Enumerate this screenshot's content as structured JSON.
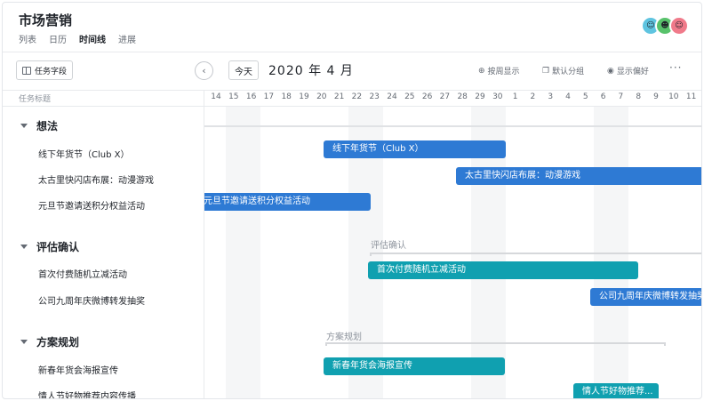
{
  "header": {
    "title": "市场营销",
    "tabs": [
      "列表",
      "日历",
      "时间线",
      "进展"
    ],
    "active_tab": "时间线",
    "avatars": [
      {
        "initial": "☺",
        "color": "#5fc4e0"
      },
      {
        "initial": "☻",
        "color": "#58c26b"
      },
      {
        "initial": "☺",
        "color": "#f07a8a"
      }
    ]
  },
  "toolbar": {
    "fields_label": "任务字段",
    "prev_icon": "chevron-left-icon",
    "today_label": "今天",
    "month": "2020 年 4 月",
    "week_label": "按周显示",
    "group_label": "默认分组",
    "prefs_label": "显示偏好",
    "more_label": "···"
  },
  "grid": {
    "column_title": "任务标题",
    "days": [
      "14",
      "15",
      "16",
      "17",
      "18",
      "19",
      "20",
      "21",
      "22",
      "23",
      "24",
      "25",
      "26",
      "27",
      "28",
      "29",
      "30",
      "1",
      "2",
      "3",
      "4",
      "5",
      "6",
      "7",
      "8",
      "9",
      "10",
      "11",
      "12",
      "13"
    ]
  },
  "groups": [
    {
      "name": "想法",
      "tasks": [
        {
          "name": "线下年货节（Club X）",
          "bar_label": "线下年货节（Club X）",
          "color": "blue"
        },
        {
          "name": "太古里快闪店布展：动漫游戏",
          "bar_label": "太古里快闪店布展：动漫游戏",
          "color": "blue"
        },
        {
          "name": "元旦节邀请送积分权益活动",
          "bar_label": "元旦节邀请送积分权益活动",
          "color": "blue"
        }
      ]
    },
    {
      "name": "评估确认",
      "summary_label": "评估确认",
      "tasks": [
        {
          "name": "首次付费随机立减活动",
          "bar_label": "首次付费随机立减活动",
          "color": "teal"
        },
        {
          "name": "公司九周年庆微博转发抽奖",
          "bar_label": "公司九周年庆微博转发抽奖",
          "color": "blue"
        }
      ]
    },
    {
      "name": "方案规划",
      "summary_label": "方案规划",
      "tasks": [
        {
          "name": "新春年货会海报宣传",
          "bar_label": "新春年货会海报宣传",
          "color": "teal"
        },
        {
          "name": "情人节好物推荐内容传播",
          "bar_label": "情人节好物推荐...",
          "color": "teal"
        }
      ]
    }
  ],
  "colors": {
    "blue": "#2e7ad4",
    "teal": "#10a0b0"
  }
}
